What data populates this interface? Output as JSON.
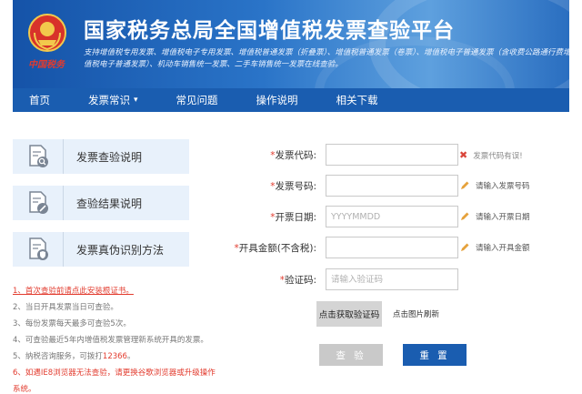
{
  "header": {
    "title": "国家税务总局全国增值税发票查验平台",
    "brand_script": "中国税务",
    "description": "支持增值税专用发票、增值税电子专用发票、增值税普通发票（折叠票）、增值税普通发票（卷票）、增值税电子普通发票（含收费公路通行费增值税电子普通发票）、机动车销售统一发票、二手车销售统一发票在线查验。"
  },
  "nav": {
    "items": [
      {
        "label": "首页"
      },
      {
        "label": "发票常识"
      },
      {
        "label": "常见问题"
      },
      {
        "label": "操作说明"
      },
      {
        "label": "相关下载"
      }
    ]
  },
  "sidebar": {
    "cards": [
      {
        "label": "发票查验说明",
        "icon": "doc-search-icon"
      },
      {
        "label": "查验结果说明",
        "icon": "doc-edit-icon"
      },
      {
        "label": "发票真伪识别方法",
        "icon": "doc-shield-icon"
      }
    ]
  },
  "notes": {
    "n1": "1、首次查验前请点此安装根证书。",
    "n2": "2、当日开具发票当日可查验。",
    "n3": "3、每份发票每天最多可查验5次。",
    "n4": "4、可查验最近5年内增值税发票管理新系统开具的发票。",
    "n5_prefix": "5、纳税咨询服务，可拨打",
    "n5_phone": "12366",
    "n5_suffix": "。",
    "n6": "6、如遇IE8浏览器无法查验，请更换谷歌浏览器或升级操作系统。"
  },
  "form": {
    "invoice_code": {
      "label": "发票代码:",
      "value": "",
      "placeholder": "",
      "hint": "发票代码有误!"
    },
    "invoice_number": {
      "label": "发票号码:",
      "value": "",
      "placeholder": "",
      "hint": "请输入发票号码"
    },
    "issue_date": {
      "label": "开票日期:",
      "value": "",
      "placeholder": "YYYYMMDD",
      "hint": "请输入开票日期"
    },
    "amount": {
      "label": "开具金额(不含税):",
      "value": "",
      "placeholder": "",
      "hint": "请输入开具金额"
    },
    "captcha": {
      "label": "验证码:",
      "value": "",
      "placeholder": "请输入验证码"
    },
    "captcha_image_text": "点击获取验证码",
    "captcha_refresh": "点击图片刷新",
    "query_button": "查 验",
    "reset_button": "重 置"
  },
  "colors": {
    "brand_blue": "#1a5db0",
    "error_red": "#e23b2e",
    "card_bg": "#e8f1fb",
    "disabled_gray": "#c9c9c9"
  }
}
